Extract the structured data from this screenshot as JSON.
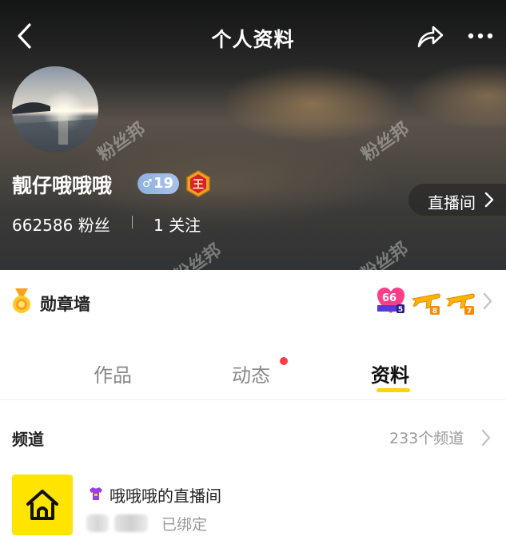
{
  "header": {
    "title": "个人资料",
    "back_icon": "back-chevron-icon",
    "share_icon": "share-icon",
    "more_icon": "more-dots-icon"
  },
  "profile": {
    "name": "靓仔哦哦哦",
    "level": "19",
    "gender_symbol": "♂",
    "rank_badge_char": "王",
    "fans": "662586 粉丝",
    "following": "1 关注",
    "live_button": "直播间"
  },
  "watermark_text": "粉丝邦",
  "medal_wall": {
    "label": "勋章墙",
    "badges": [
      {
        "icon": "heart-66-badge-icon",
        "text": "66",
        "level": "5"
      },
      {
        "icon": "plane-badge-icon",
        "level": "8"
      },
      {
        "icon": "plane-badge-icon",
        "level": "7"
      }
    ]
  },
  "tabs": [
    {
      "label": "作品",
      "active": false,
      "has_dot": false
    },
    {
      "label": "动态",
      "active": false,
      "has_dot": true
    },
    {
      "label": "资料",
      "active": true,
      "has_dot": false
    }
  ],
  "channels": {
    "title": "频道",
    "count_label": "233个频道",
    "items": [
      {
        "name": "哦哦哦的直播间",
        "status": "已绑定",
        "icon": "home-icon",
        "tag_icon": "shirt-icon"
      }
    ]
  },
  "colors": {
    "accent_yellow": "#ffd20f",
    "thumb_yellow": "#ffe400",
    "dot_red": "#ff3b48",
    "level_badge_blue": "#9ab8e4"
  }
}
